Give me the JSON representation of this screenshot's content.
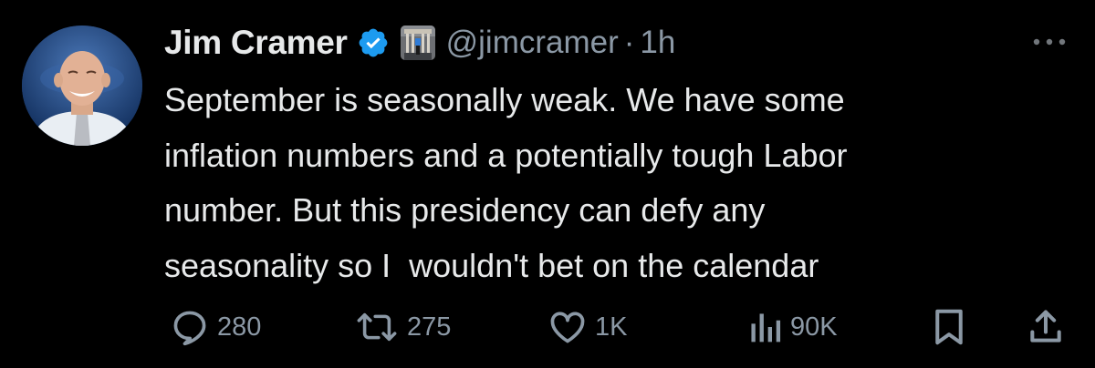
{
  "author": {
    "display_name": "Jim Cramer",
    "handle": "@jimcramer",
    "separator": "·",
    "time_ago": "1h",
    "verified_color": "#1d9bf0"
  },
  "tweet": {
    "text_lines": [
      "September is seasonally weak. We have some",
      "inflation numbers and a potentially tough Labor",
      "number. But this presidency can defy any",
      "seasonality so I  wouldn't bet on the calendar"
    ]
  },
  "actions": {
    "reply": {
      "icon": "reply-icon",
      "count": "280"
    },
    "retweet": {
      "icon": "retweet-icon",
      "count": "275"
    },
    "like": {
      "icon": "like-icon",
      "count": "1K"
    },
    "views": {
      "icon": "views-icon",
      "count": "90K"
    },
    "bookmark": {
      "icon": "bookmark-icon"
    },
    "share": {
      "icon": "share-icon"
    }
  },
  "colors": {
    "background": "#000000",
    "text": "#e7e9ea",
    "secondary_text": "#8b98a5"
  }
}
